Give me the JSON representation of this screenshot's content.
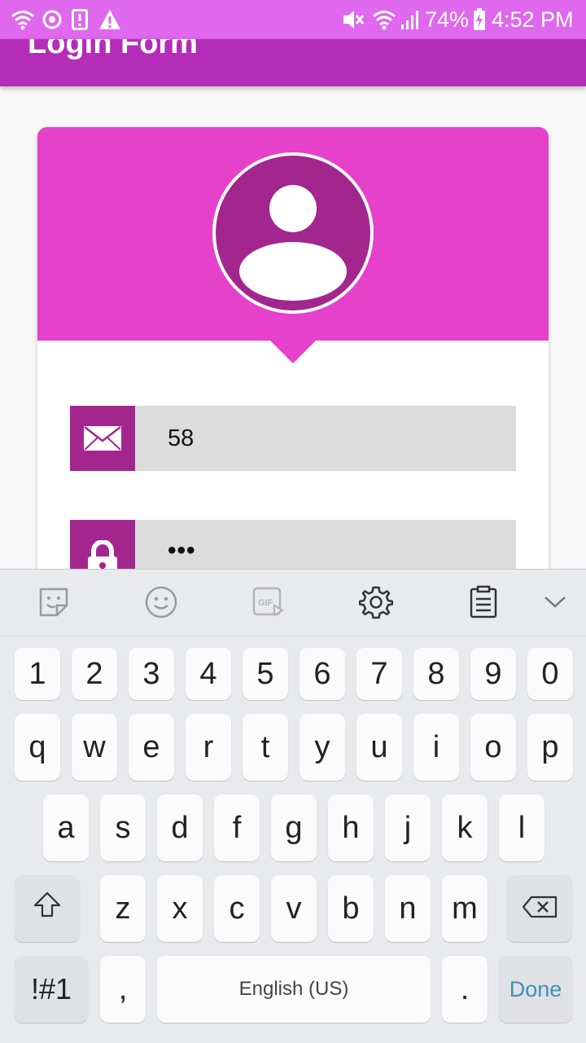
{
  "status_bar": {
    "battery": "74%",
    "time": "4:52 PM",
    "left_icons": [
      "wifi-calling-icon",
      "data-saver-icon",
      "notification-alert-icon",
      "warning-icon"
    ],
    "right_icons": [
      "vibrate-icon",
      "wifi-icon",
      "signal-icon",
      "battery-charging-icon"
    ]
  },
  "app_bar": {
    "title": "Login Form"
  },
  "form": {
    "avatar_icon": "user-avatar-icon",
    "email": {
      "icon": "mail-icon",
      "value": "58"
    },
    "password": {
      "icon": "lock-icon",
      "value": "•••"
    },
    "colors": {
      "header": "#e541cb",
      "icon_bg": "#a3268f",
      "app_bar": "#b42db9",
      "status_bar": "#df68ee",
      "field_bg": "#dcdcdc"
    }
  },
  "keyboard": {
    "toolbar": [
      "sticker-icon",
      "emoji-icon",
      "gif-icon",
      "settings-icon",
      "clipboard-icon",
      "collapse-icon"
    ],
    "rows": {
      "numbers": [
        "1",
        "2",
        "3",
        "4",
        "5",
        "6",
        "7",
        "8",
        "9",
        "0"
      ],
      "row1": [
        "q",
        "w",
        "e",
        "r",
        "t",
        "y",
        "u",
        "i",
        "o",
        "p"
      ],
      "row2": [
        "a",
        "s",
        "d",
        "f",
        "g",
        "h",
        "j",
        "k",
        "l"
      ],
      "row3": [
        "z",
        "x",
        "c",
        "v",
        "b",
        "n",
        "m"
      ]
    },
    "symbols_label": "!#1",
    "comma_label": ",",
    "space_label": "English (US)",
    "period_label": ".",
    "done_label": "Done",
    "done_color": "#3f8fb6"
  }
}
